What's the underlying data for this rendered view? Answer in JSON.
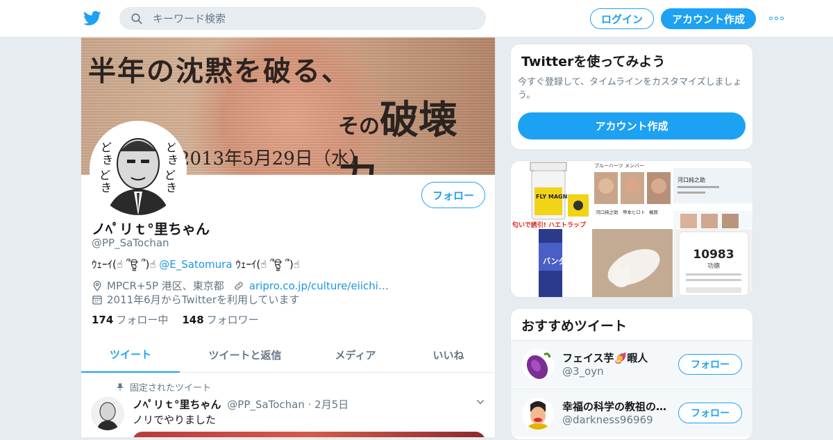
{
  "topbar": {
    "search_placeholder": "キーワード検索",
    "login_label": "ログイン",
    "signup_label": "アカウント作成"
  },
  "header": {
    "headline1": "半年の沈黙を破る、",
    "headline2_small": "その",
    "headline2_big": "破壊力。",
    "headline3": "2013年5月29日（水）",
    "avatar_text": [
      "ど",
      "き",
      "ど",
      "き",
      "ど",
      "き",
      "ど",
      "き"
    ]
  },
  "profile": {
    "follow_label": "フォロー",
    "name": "ノﾍﾟリｔ°里ちゃん",
    "handle": "@PP_SaTochan",
    "bio_prefix": "ｳｪｰｲ(☝ ՞ਊ ՞)☝",
    "bio_mention": "@E_Satomura",
    "bio_suffix": "ｳｪｰｲ(☝ ՞ਊ ՞)☝",
    "location": "MPCR+5P 港区、東京都",
    "website": "aripro.co.jp/culture/eiichi…",
    "joined": "2011年6月からTwitterを利用しています",
    "following_count": "174",
    "following_label": "フォロー中",
    "followers_count": "148",
    "followers_label": "フォロワー"
  },
  "tabs": [
    {
      "label": "ツイート",
      "active": true
    },
    {
      "label": "ツイートと返信",
      "active": false
    },
    {
      "label": "メディア",
      "active": false
    },
    {
      "label": "いいね",
      "active": false
    }
  ],
  "pinned_tweet": {
    "pinned_label": "固定されたツイート",
    "name": "ノﾍﾟリｔ°里ちゃん",
    "handle": "@PP_SaTochan",
    "date": "· 2月5日",
    "text": "ノリでやりました"
  },
  "signup_card": {
    "title": "Twitterを使ってみよう",
    "description": "今すぐ登録して、タイムラインをカスタマイズしましょう。",
    "button_label": "アカウント作成"
  },
  "media_card": {
    "fly_label": "FLY MAGNET",
    "fly_caption": "匂いで誘引! ハエトラップ",
    "spray_label": "バンダ",
    "members_label": "ブルーハーツ メンバー",
    "member_names": [
      "河口純之助",
      "甲本ヒロト",
      "梶原"
    ],
    "app_name": "河口純之助",
    "counter_value": "10983",
    "counter_label": "功德"
  },
  "recommended": {
    "title": "おすすめツイート",
    "users": [
      {
        "name": "フェイス芋🍠暇人",
        "handle": "@3_oyn",
        "follow_label": "フォロー"
      },
      {
        "name": "幸福の科学の教祖の…",
        "handle": "@darkness96969",
        "follow_label": "フォロー"
      }
    ]
  },
  "colors": {
    "accent": "#1da1f2",
    "link": "#1b95e0",
    "secondary_text": "#657786",
    "page_bg": "#e6ecf0"
  }
}
